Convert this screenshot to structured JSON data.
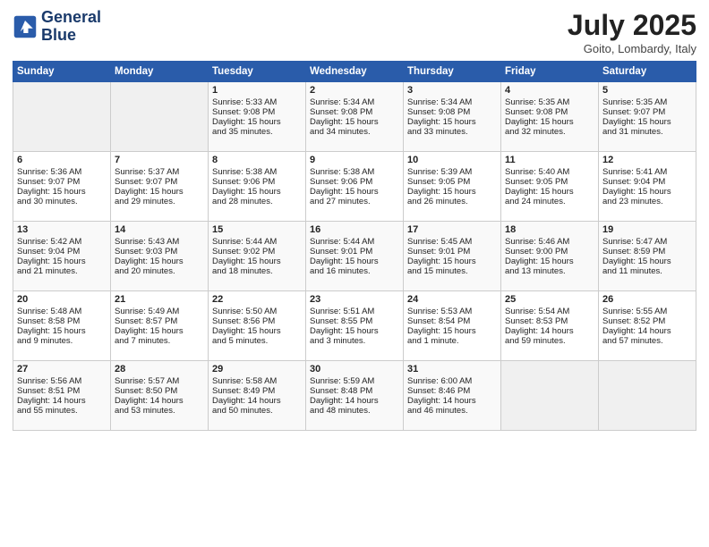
{
  "header": {
    "logo_line1": "General",
    "logo_line2": "Blue",
    "month": "July 2025",
    "location": "Goito, Lombardy, Italy"
  },
  "weekdays": [
    "Sunday",
    "Monday",
    "Tuesday",
    "Wednesday",
    "Thursday",
    "Friday",
    "Saturday"
  ],
  "weeks": [
    [
      {
        "day": "",
        "text": ""
      },
      {
        "day": "",
        "text": ""
      },
      {
        "day": "1",
        "text": "Sunrise: 5:33 AM\nSunset: 9:08 PM\nDaylight: 15 hours\nand 35 minutes."
      },
      {
        "day": "2",
        "text": "Sunrise: 5:34 AM\nSunset: 9:08 PM\nDaylight: 15 hours\nand 34 minutes."
      },
      {
        "day": "3",
        "text": "Sunrise: 5:34 AM\nSunset: 9:08 PM\nDaylight: 15 hours\nand 33 minutes."
      },
      {
        "day": "4",
        "text": "Sunrise: 5:35 AM\nSunset: 9:08 PM\nDaylight: 15 hours\nand 32 minutes."
      },
      {
        "day": "5",
        "text": "Sunrise: 5:35 AM\nSunset: 9:07 PM\nDaylight: 15 hours\nand 31 minutes."
      }
    ],
    [
      {
        "day": "6",
        "text": "Sunrise: 5:36 AM\nSunset: 9:07 PM\nDaylight: 15 hours\nand 30 minutes."
      },
      {
        "day": "7",
        "text": "Sunrise: 5:37 AM\nSunset: 9:07 PM\nDaylight: 15 hours\nand 29 minutes."
      },
      {
        "day": "8",
        "text": "Sunrise: 5:38 AM\nSunset: 9:06 PM\nDaylight: 15 hours\nand 28 minutes."
      },
      {
        "day": "9",
        "text": "Sunrise: 5:38 AM\nSunset: 9:06 PM\nDaylight: 15 hours\nand 27 minutes."
      },
      {
        "day": "10",
        "text": "Sunrise: 5:39 AM\nSunset: 9:05 PM\nDaylight: 15 hours\nand 26 minutes."
      },
      {
        "day": "11",
        "text": "Sunrise: 5:40 AM\nSunset: 9:05 PM\nDaylight: 15 hours\nand 24 minutes."
      },
      {
        "day": "12",
        "text": "Sunrise: 5:41 AM\nSunset: 9:04 PM\nDaylight: 15 hours\nand 23 minutes."
      }
    ],
    [
      {
        "day": "13",
        "text": "Sunrise: 5:42 AM\nSunset: 9:04 PM\nDaylight: 15 hours\nand 21 minutes."
      },
      {
        "day": "14",
        "text": "Sunrise: 5:43 AM\nSunset: 9:03 PM\nDaylight: 15 hours\nand 20 minutes."
      },
      {
        "day": "15",
        "text": "Sunrise: 5:44 AM\nSunset: 9:02 PM\nDaylight: 15 hours\nand 18 minutes."
      },
      {
        "day": "16",
        "text": "Sunrise: 5:44 AM\nSunset: 9:01 PM\nDaylight: 15 hours\nand 16 minutes."
      },
      {
        "day": "17",
        "text": "Sunrise: 5:45 AM\nSunset: 9:01 PM\nDaylight: 15 hours\nand 15 minutes."
      },
      {
        "day": "18",
        "text": "Sunrise: 5:46 AM\nSunset: 9:00 PM\nDaylight: 15 hours\nand 13 minutes."
      },
      {
        "day": "19",
        "text": "Sunrise: 5:47 AM\nSunset: 8:59 PM\nDaylight: 15 hours\nand 11 minutes."
      }
    ],
    [
      {
        "day": "20",
        "text": "Sunrise: 5:48 AM\nSunset: 8:58 PM\nDaylight: 15 hours\nand 9 minutes."
      },
      {
        "day": "21",
        "text": "Sunrise: 5:49 AM\nSunset: 8:57 PM\nDaylight: 15 hours\nand 7 minutes."
      },
      {
        "day": "22",
        "text": "Sunrise: 5:50 AM\nSunset: 8:56 PM\nDaylight: 15 hours\nand 5 minutes."
      },
      {
        "day": "23",
        "text": "Sunrise: 5:51 AM\nSunset: 8:55 PM\nDaylight: 15 hours\nand 3 minutes."
      },
      {
        "day": "24",
        "text": "Sunrise: 5:53 AM\nSunset: 8:54 PM\nDaylight: 15 hours\nand 1 minute."
      },
      {
        "day": "25",
        "text": "Sunrise: 5:54 AM\nSunset: 8:53 PM\nDaylight: 14 hours\nand 59 minutes."
      },
      {
        "day": "26",
        "text": "Sunrise: 5:55 AM\nSunset: 8:52 PM\nDaylight: 14 hours\nand 57 minutes."
      }
    ],
    [
      {
        "day": "27",
        "text": "Sunrise: 5:56 AM\nSunset: 8:51 PM\nDaylight: 14 hours\nand 55 minutes."
      },
      {
        "day": "28",
        "text": "Sunrise: 5:57 AM\nSunset: 8:50 PM\nDaylight: 14 hours\nand 53 minutes."
      },
      {
        "day": "29",
        "text": "Sunrise: 5:58 AM\nSunset: 8:49 PM\nDaylight: 14 hours\nand 50 minutes."
      },
      {
        "day": "30",
        "text": "Sunrise: 5:59 AM\nSunset: 8:48 PM\nDaylight: 14 hours\nand 48 minutes."
      },
      {
        "day": "31",
        "text": "Sunrise: 6:00 AM\nSunset: 8:46 PM\nDaylight: 14 hours\nand 46 minutes."
      },
      {
        "day": "",
        "text": ""
      },
      {
        "day": "",
        "text": ""
      }
    ]
  ]
}
